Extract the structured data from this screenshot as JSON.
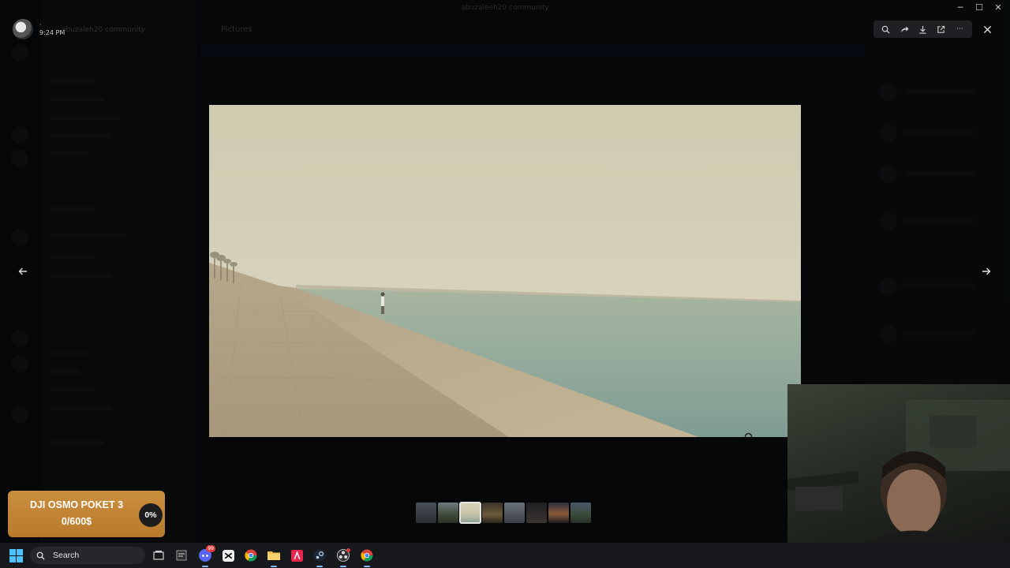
{
  "window": {
    "title": "abuzaleeh20 community",
    "minimize_glyph": "─",
    "maximize_glyph": "☐",
    "close_glyph": "✕"
  },
  "uploader": {
    "name": "·",
    "time": "9:24 PM",
    "channel": "abuzaleh20 community"
  },
  "tab": {
    "label": "Pictures"
  },
  "viewer_toolbar": {
    "icons": [
      "zoom-icon",
      "forward-icon",
      "download-icon",
      "open-external-icon",
      "more-icon"
    ],
    "more_glyph": "···"
  },
  "thumbnails": {
    "count": 8,
    "selected_index": 2
  },
  "donation": {
    "title": "DJI OSMO POKET 3",
    "amount": "0/600$",
    "percent": "0%",
    "progress": 0
  },
  "taskbar": {
    "search_label": "Search",
    "apps": [
      "task-view",
      "dev-app",
      "discord",
      "capcut",
      "chrome",
      "file-explorer",
      "adobe-app",
      "steam",
      "obs",
      "chrome-alt"
    ],
    "discord_badge": "99"
  },
  "colors": {
    "accent": "#5865f2",
    "donation_bg": "#c18636",
    "toolbar_bg": "#1f2023"
  }
}
